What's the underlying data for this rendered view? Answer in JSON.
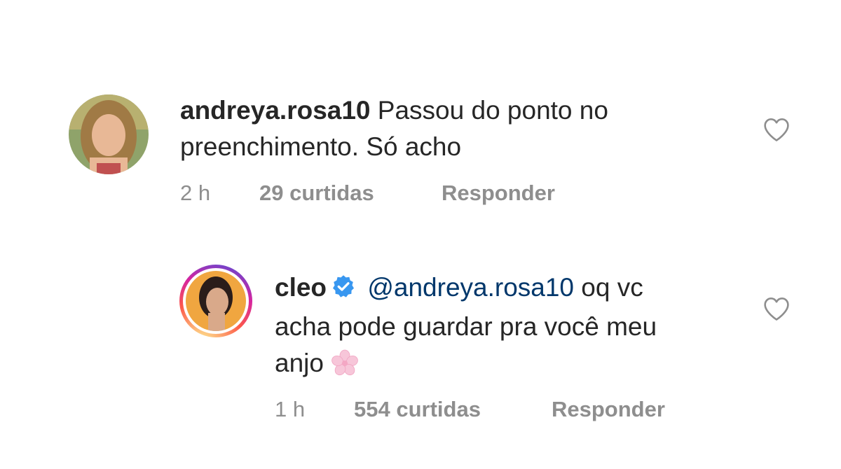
{
  "comments": [
    {
      "username": "andreya.rosa10",
      "text_line1": "Passou do ponto no",
      "text_line2": "preenchimento. Só acho",
      "time": "2 h",
      "likes": "29 curtidas",
      "reply_label": "Responder"
    },
    {
      "username": "cleo",
      "mention": "@andreya.rosa10",
      "text_line1_rest": "oq vc",
      "text_line2": "acha pode guardar pra você meu",
      "text_line3": "anjo",
      "time": "1 h",
      "likes": "554 curtidas",
      "reply_label": "Responder",
      "verified": true
    }
  ],
  "icons": {
    "like": "heart-outline-icon",
    "verified": "verified-badge-icon",
    "emoji": "cherry-blossom-emoji"
  },
  "colors": {
    "text": "#262626",
    "meta": "#8e8e8e",
    "mention": "#00376b",
    "verified": "#3897f0"
  }
}
